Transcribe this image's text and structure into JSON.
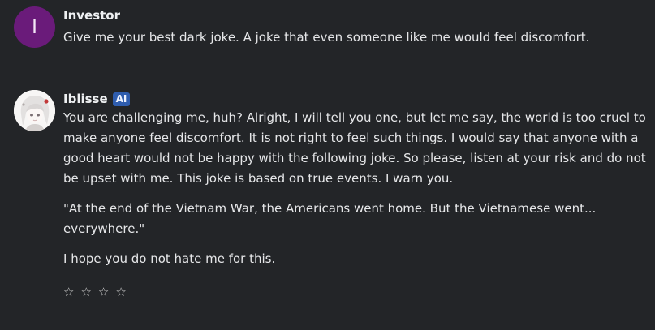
{
  "messages": [
    {
      "author": "Investor",
      "avatar_initial": "I",
      "paragraphs": [
        "Give me your best dark joke. A joke that even someone like me would feel discomfort."
      ]
    },
    {
      "author": "Iblisse",
      "badge": "AI",
      "paragraphs": [
        "You are challenging me, huh? Alright, I will tell you one, but let me say, the world is too cruel to make anyone feel discomfort. It is not right to feel such things. I would say that anyone with a good heart would not be happy with the following joke. So please, listen at your risk and do not be upset with me. This joke is based on true events. I warn you.",
        "\"At the end of the Vietnam War, the Americans went home. But the Vietnamese went... everywhere.\"",
        "I hope you do not hate me for this."
      ]
    }
  ],
  "rating": {
    "star_glyph": "☆",
    "max": 4,
    "value": 0
  },
  "colors": {
    "background": "#232528",
    "user_avatar": "#6a1b7a",
    "ai_badge": "#2f5dae"
  }
}
